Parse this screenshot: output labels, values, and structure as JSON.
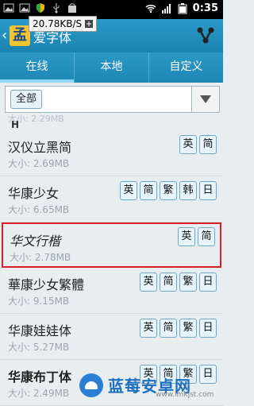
{
  "status": {
    "speed": "20.78KB/S",
    "time": "0:35"
  },
  "app": {
    "title": "爱字体",
    "logo_text": "孟"
  },
  "tabs": [
    {
      "label": "在线"
    },
    {
      "label": "本地"
    },
    {
      "label": "自定义"
    }
  ],
  "filter": {
    "selected": "全部"
  },
  "section": {
    "letter": "H",
    "faint": "大小: 2.29MB"
  },
  "items": [
    {
      "name": "汉仪立黑简",
      "size": "大小: 2.69MB",
      "langs": [
        "英",
        "简"
      ]
    },
    {
      "name": "华康少女",
      "size": "大小: 6.65MB",
      "langs": [
        "英",
        "简",
        "繁",
        "韩",
        "日"
      ]
    },
    {
      "name": "华文行楷",
      "size": "大小: 2.78MB",
      "langs": [
        "英",
        "简"
      ],
      "selected": true
    },
    {
      "name": "華康少女繁體",
      "size": "大小: 9.15MB",
      "langs": [
        "英",
        "简",
        "繁",
        "日"
      ]
    },
    {
      "name": "华康娃娃体",
      "size": "大小: 5.27MB",
      "langs": [
        "英",
        "简",
        "繁",
        "日"
      ]
    },
    {
      "name": "华康布丁体",
      "size": "大小: 2.49MB",
      "langs": [
        "英",
        "简",
        "繁",
        "日"
      ]
    }
  ],
  "watermark": {
    "text": "蓝莓安卓网",
    "url": "www.lmkjst.com"
  },
  "colors": {
    "accent": "#1d86b4",
    "selected_border": "#d61f26"
  }
}
